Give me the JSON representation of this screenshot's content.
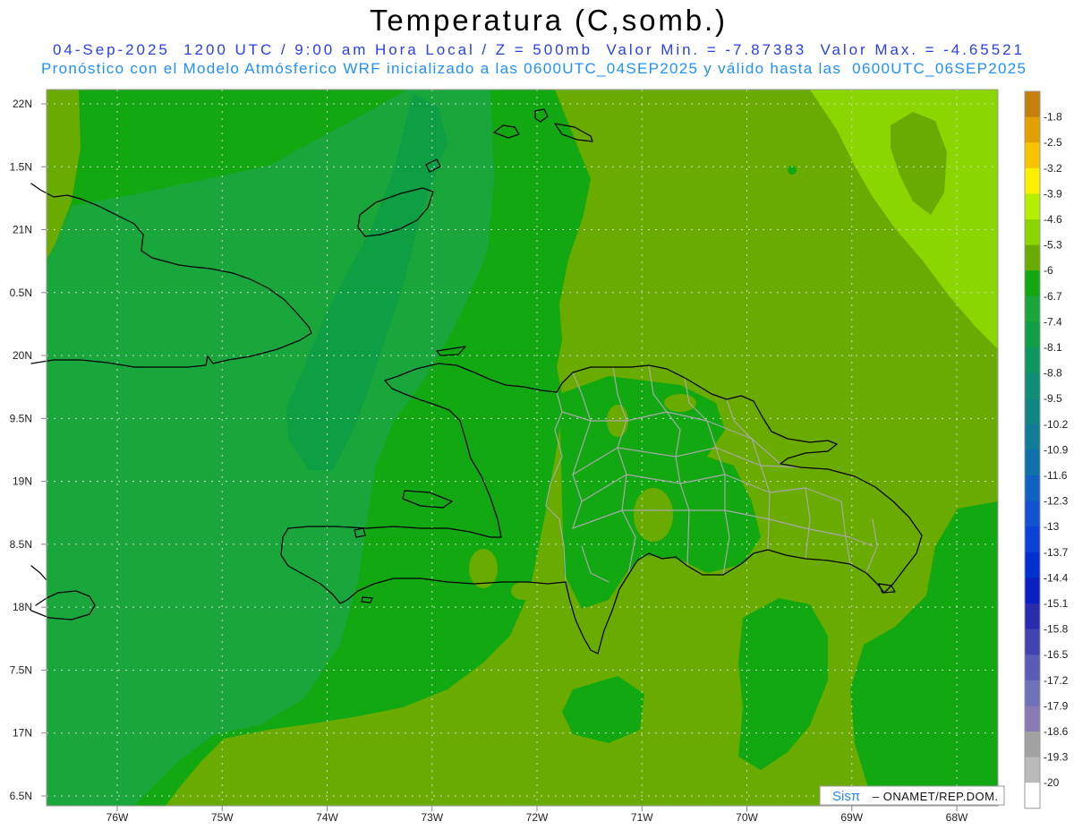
{
  "title": "Temperatura (C,somb.)",
  "header": {
    "line1": "04-Sep-2025  1200 UTC / 9:00 am Hora Local / Z = 500mb  Valor Min. = -7.87383  Valor Max. = -4.65521",
    "line2": "Pronóstico con el Modelo Atmósferico WRF inicializado a las 0600UTC_04SEP2025 y válido hasta las  0600UTC_06SEP2025"
  },
  "axes": {
    "lat_labels": [
      "22N",
      "1.5N",
      "21N",
      "0.5N",
      "20N",
      "9.5N",
      "19N",
      "8.5N",
      "18N",
      "7.5N",
      "17N",
      "6.5N"
    ],
    "lon_labels": [
      "76W",
      "75W",
      "74W",
      "73W",
      "72W",
      "71W",
      "70W",
      "69W",
      "68W"
    ]
  },
  "legend": {
    "labels": [
      "-1.8",
      "-2.5",
      "-3.2",
      "-3.9",
      "-4.6",
      "-5.3",
      "-6",
      "-6.7",
      "-7.4",
      "-8.1",
      "-8.8",
      "-9.5",
      "-10.2",
      "-10.9",
      "-11.6",
      "-12.3",
      "-13",
      "-13.7",
      "-14.4",
      "-15.1",
      "-15.8",
      "-16.5",
      "-17.2",
      "-17.9",
      "-18.6",
      "-19.3",
      "-20"
    ],
    "colors": [
      "#c4800a",
      "#e4a000",
      "#f6c400",
      "#fbf000",
      "#b6ee00",
      "#8cd600",
      "#6aab00",
      "#12a812",
      "#19a63a",
      "#0e9e44",
      "#0c9660",
      "#0e8e74",
      "#0f8684",
      "#107c96",
      "#1070ac",
      "#1062c2",
      "#1052d0",
      "#0a42d6",
      "#0030d0",
      "#0a20c0",
      "#2a2cb0",
      "#4242b2",
      "#5a5ab8",
      "#7070b8",
      "#8a7ab4",
      "#a2a2a2",
      "#bababa",
      "#ffffff"
    ]
  },
  "logo": {
    "brand": "Sisπ",
    "credit": "– ONAMET/REP.DOM."
  },
  "colors": {
    "title": "#000000",
    "header_line1": "#2a40e8",
    "header_line2": "#1e90ff",
    "brand": "#1e88ff",
    "coastline": "#000000",
    "borders": "#a8a8a8",
    "grid": "#d6d6d6",
    "frame": "#999999"
  }
}
